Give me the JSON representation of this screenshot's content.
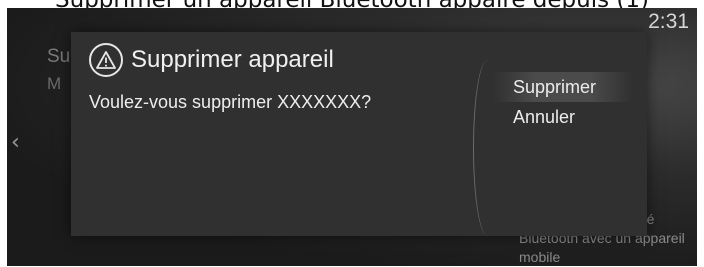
{
  "caption": "Supprimer un appareil Bluetooth appairé depuis (1)",
  "status_bar": {
    "time": "2:31"
  },
  "background": {
    "title": "Su",
    "subtitle": "M",
    "hint": "Activer la connectivité Bluetooth avec un appareil mobile"
  },
  "dialog": {
    "title": "Supprimer appareil",
    "message": "Voulez-vous supprimer XXXXXXX?",
    "options": [
      {
        "label": "Supprimer",
        "selected": true
      },
      {
        "label": "Annuler",
        "selected": false
      }
    ]
  }
}
